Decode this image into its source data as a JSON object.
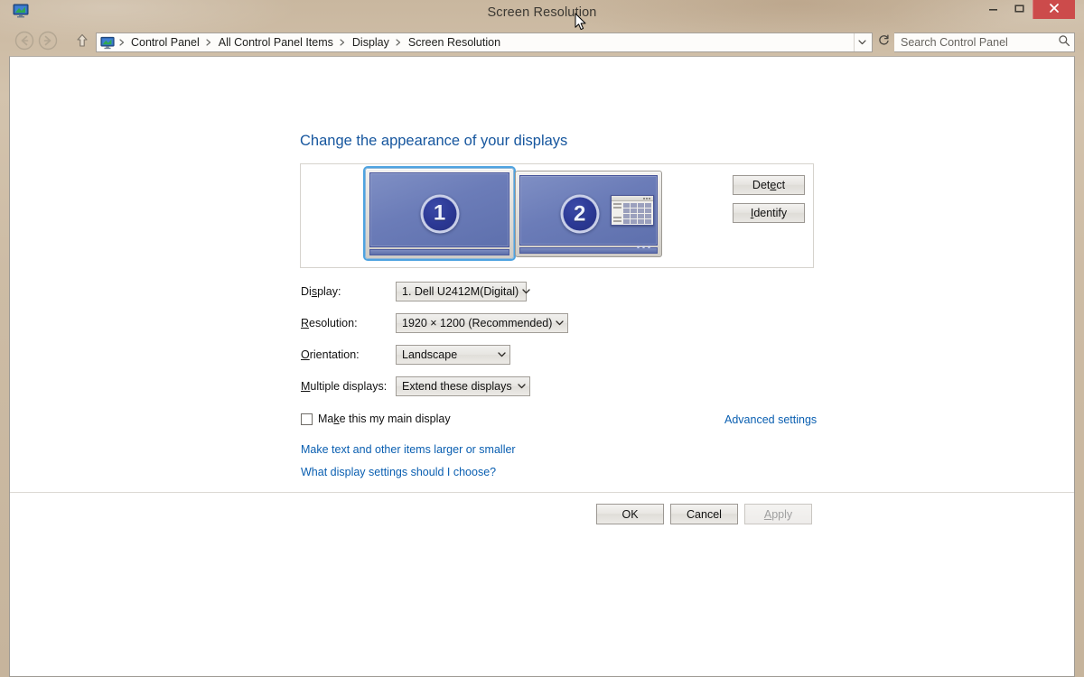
{
  "window": {
    "title": "Screen Resolution",
    "app_icon": "display-monitor-icon",
    "caption": {
      "minimize": "minimize-icon",
      "maximize": "maximize-icon",
      "close": "close-icon",
      "close_color": "#cc4b4b"
    }
  },
  "toolbar": {
    "back": "back-arrow-icon",
    "forward": "forward-arrow-icon",
    "up": "up-arrow-icon",
    "breadcrumb_icon": "display-monitor-icon",
    "breadcrumbs": [
      "Control Panel",
      "All Control Panel Items",
      "Display",
      "Screen Resolution"
    ],
    "dropdown": "chevron-down-icon",
    "refresh": "refresh-icon",
    "search": {
      "placeholder": "Search Control Panel",
      "value": "",
      "icon": "search-icon"
    }
  },
  "main": {
    "heading": "Change the appearance of your displays",
    "monitors": [
      {
        "number": "1",
        "selected": true
      },
      {
        "number": "2",
        "selected": false
      }
    ],
    "detect_label": "Detect",
    "detect_accel_pre": "Det",
    "detect_accel": "e",
    "detect_accel_post": "ct",
    "identify_accel": "I",
    "identify_accel_post": "dentify",
    "fields": [
      {
        "label_pre": "Di",
        "label_accel": "s",
        "label_post": "play:",
        "value": "1. Dell U2412M(Digital)"
      },
      {
        "label_pre": "",
        "label_accel": "R",
        "label_post": "esolution:",
        "value": "1920 × 1200 (Recommended)"
      },
      {
        "label_pre": "",
        "label_accel": "O",
        "label_post": "rientation:",
        "value": "Landscape"
      },
      {
        "label_pre": "",
        "label_accel": "M",
        "label_post": "ultiple displays:",
        "value": "Extend these displays"
      }
    ],
    "checkbox": {
      "pre": "Ma",
      "accel": "k",
      "post": "e this my main display",
      "checked": false
    },
    "advanced_settings_link": "Advanced settings",
    "links": [
      "Make text and other items larger or smaller",
      "What display settings should I choose?"
    ]
  },
  "footer": {
    "ok": "OK",
    "cancel": "Cancel",
    "apply_accel": "A",
    "apply_accel_post": "pply",
    "apply_disabled": true
  },
  "colors": {
    "frame": "#cdbca5",
    "heading": "#16569e",
    "link": "#0a5fb1",
    "accent_selection": "#4ea3e0",
    "screen": "#6b7cb8",
    "badge": "#2b3894"
  }
}
